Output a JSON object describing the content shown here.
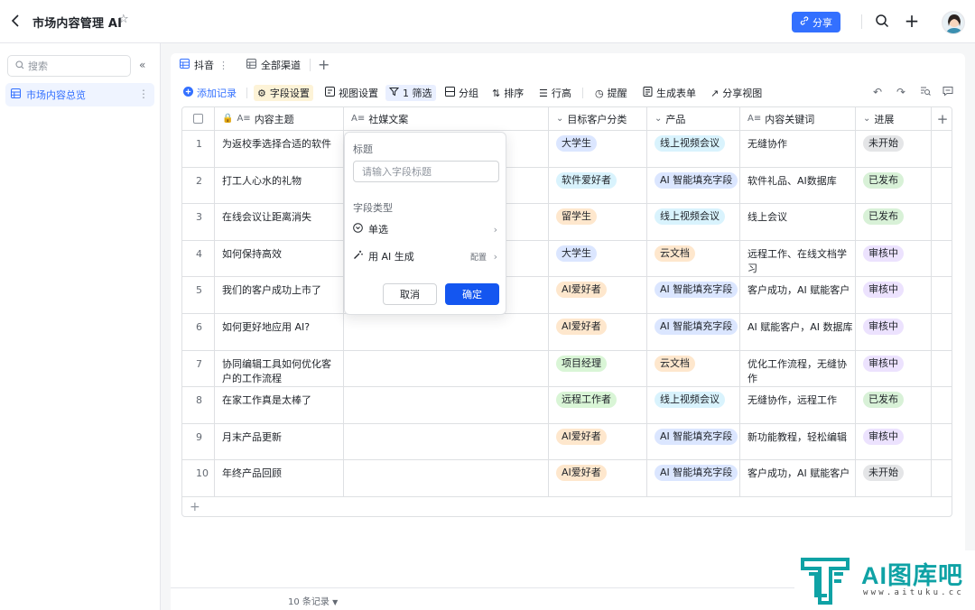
{
  "header": {
    "title": "市场内容管理 AI",
    "share_label": "分享"
  },
  "sidebar": {
    "search_placeholder": "搜索",
    "items": [
      {
        "label": "市场内容总览"
      }
    ]
  },
  "tabs": [
    {
      "label": "抖音",
      "active": true
    },
    {
      "label": "全部渠道",
      "active": false
    }
  ],
  "toolbar": {
    "add_record": "添加记录",
    "field_settings": "字段设置",
    "view_settings": "视图设置",
    "filter": "1 筛选",
    "group": "分组",
    "sort": "排序",
    "row_height": "行高",
    "remind": "提醒",
    "generate_form": "生成表单",
    "share_view": "分享视图"
  },
  "table": {
    "columns": [
      "内容主题",
      "社媒文案",
      "目标客户分类",
      "产品",
      "内容关键词",
      "进展"
    ],
    "rows": [
      {
        "num": "1",
        "topic": "为返校季选择合适的软件",
        "copy": "",
        "customer": "大学生",
        "product": "线上视频会议",
        "keywords": "无缝协作",
        "status": "未开始"
      },
      {
        "num": "2",
        "topic": "打工人心水的礼物",
        "copy": "",
        "customer": "软件爱好者",
        "product": "AI 智能填充字段",
        "keywords": "软件礼品、AI数据库",
        "status": "已发布"
      },
      {
        "num": "3",
        "topic": "在线会议让距离消失",
        "copy": "",
        "customer": "留学生",
        "product": "线上视频会议",
        "keywords": "线上会议",
        "status": "已发布"
      },
      {
        "num": "4",
        "topic": "如何保持高效",
        "copy": "",
        "customer": "大学生",
        "product": "云文档",
        "keywords": "远程工作、在线文档学习",
        "status": "审核中"
      },
      {
        "num": "5",
        "topic": "我们的客户成功上市了",
        "copy": "",
        "customer": "AI爱好者",
        "product": "AI 智能填充字段",
        "keywords": "客户成功，AI 赋能客户",
        "status": "审核中"
      },
      {
        "num": "6",
        "topic": "如何更好地应用 AI?",
        "copy": "",
        "customer": "AI爱好者",
        "product": "AI 智能填充字段",
        "keywords": "AI 赋能客户，AI 数据库",
        "status": "审核中"
      },
      {
        "num": "7",
        "topic": "协同编辑工具如何优化客户的工作流程",
        "copy": "",
        "customer": "项目经理",
        "product": "云文档",
        "keywords": "优化工作流程，无缝协作",
        "status": "审核中"
      },
      {
        "num": "8",
        "topic": "在家工作真是太棒了",
        "copy": "",
        "customer": "远程工作者",
        "product": "线上视频会议",
        "keywords": "无缝协作，远程工作",
        "status": "已发布"
      },
      {
        "num": "9",
        "topic": "月末产品更新",
        "copy": "",
        "customer": "AI爱好者",
        "product": "AI 智能填充字段",
        "keywords": "新功能教程，轻松编辑",
        "status": "审核中"
      },
      {
        "num": "10",
        "topic": "年终产品回顾",
        "copy": "",
        "customer": "AI爱好者",
        "product": "AI 智能填充字段",
        "keywords": "客户成功，AI 赋能客户",
        "status": "未开始"
      }
    ]
  },
  "footer": {
    "record_count": "10 条记录"
  },
  "popup": {
    "title_label": "标题",
    "title_placeholder": "请输入字段标题",
    "field_type_label": "字段类型",
    "option_single": "单选",
    "option_ai": "用 AI 生成",
    "config_label": "配置",
    "cancel": "取消",
    "confirm": "确定"
  },
  "watermark": {
    "brand": "AI图库吧",
    "url": "www.aituku.cc"
  },
  "colors": {
    "accent": "#3370ff",
    "confirm": "#1456f0",
    "brand_teal": "#0fa2a5",
    "customer_tags": {
      "大学生": "#dbe6ff",
      "软件爱好者": "#d9f3fd",
      "留学生": "#fee7cd",
      "AI爱好者": "#fee7cd",
      "项目经理": "#d9f5d6",
      "远程工作者": "#d9f5d6"
    },
    "product_tags": {
      "线上视频会议": "#d9f3fd",
      "AI 智能填充字段": "#dbe6ff",
      "云文档": "#fee7cd"
    },
    "status_tags": {
      "未开始": "#e4e5e7",
      "已发布": "#d8f1d7",
      "审核中": "#ece2fe"
    }
  }
}
